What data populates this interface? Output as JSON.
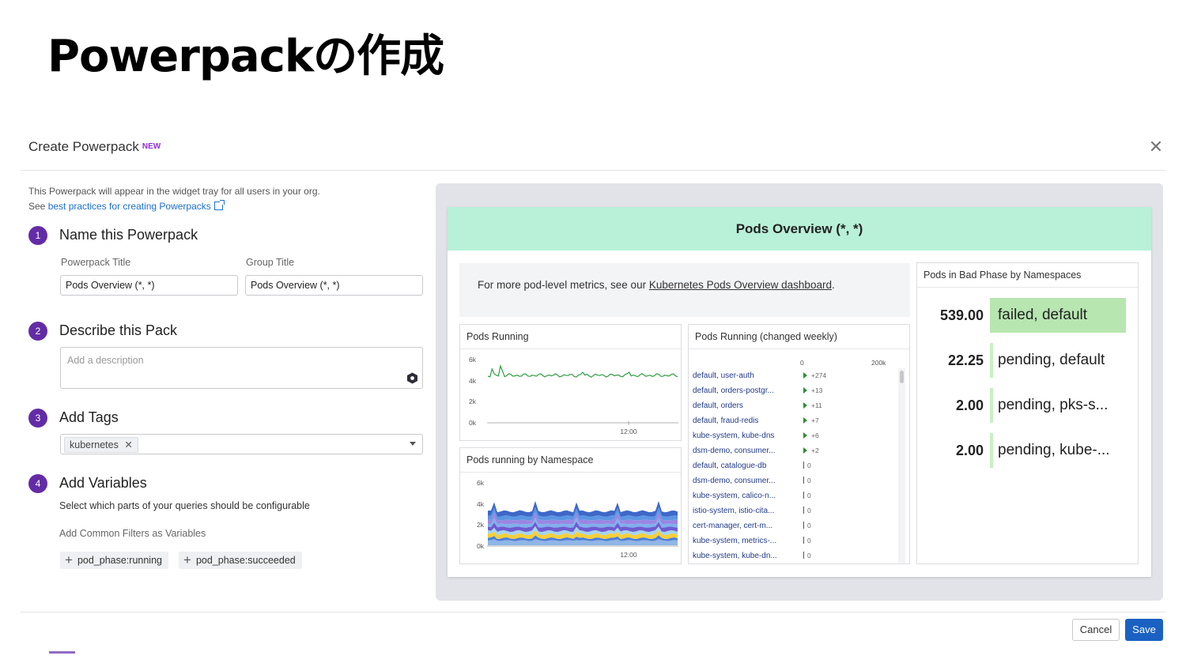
{
  "slide": {
    "title": "Powerpackの作成"
  },
  "modal": {
    "title": "Create Powerpack",
    "badge": "NEW",
    "intro_line1": "This Powerpack will appear in the widget tray for all users in your org.",
    "intro_see": "See ",
    "intro_link": "best practices for creating Powerpacks"
  },
  "steps": [
    {
      "num": "1",
      "title": "Name this Powerpack"
    },
    {
      "num": "2",
      "title": "Describe this Pack"
    },
    {
      "num": "3",
      "title": "Add Tags"
    },
    {
      "num": "4",
      "title": "Add Variables"
    }
  ],
  "name_step": {
    "powerpack_title_label": "Powerpack Title",
    "powerpack_title_value": "Pods Overview (*, *)",
    "group_title_label": "Group Title",
    "group_title_value": "Pods Overview (*, *)"
  },
  "describe_step": {
    "placeholder": "Add a description"
  },
  "tags_step": {
    "tags": [
      "kubernetes"
    ]
  },
  "variables_step": {
    "subtitle": "Select which parts of your queries should be configurable",
    "common_filters_label": "Add Common Filters as Variables",
    "filters": [
      "pod_phase:running",
      "pod_phase:succeeded"
    ]
  },
  "preview": {
    "header": "Pods Overview (*, *)",
    "note_prefix": "For more pod-level metrics, see our ",
    "note_link": "Kubernetes Pods Overview dashboard",
    "note_suffix": ".",
    "pods_running": {
      "title": "Pods Running",
      "y_ticks": [
        "6k",
        "4k",
        "2k",
        "0k"
      ],
      "x_tick": "12:00"
    },
    "pods_by_namespace": {
      "title": "Pods running by Namespace",
      "y_ticks": [
        "6k",
        "4k",
        "2k",
        "0k"
      ],
      "x_tick": "12:00"
    },
    "changed_weekly": {
      "title": "Pods Running (changed weekly)",
      "axis_left": "0",
      "axis_right": "200k",
      "rows": [
        {
          "name": "default, user-auth",
          "value": "+274",
          "up": true
        },
        {
          "name": "default, orders-postgr...",
          "value": "+13",
          "up": true
        },
        {
          "name": "default, orders",
          "value": "+11",
          "up": true
        },
        {
          "name": "default, fraud-redis",
          "value": "+7",
          "up": true
        },
        {
          "name": "kube-system, kube-dns",
          "value": "+6",
          "up": true
        },
        {
          "name": "dsm-demo, consumer...",
          "value": "+2",
          "up": true
        },
        {
          "name": "default, catalogue-db",
          "value": "0",
          "up": false
        },
        {
          "name": "dsm-demo, consumer...",
          "value": "0",
          "up": false
        },
        {
          "name": "kube-system, calico-n...",
          "value": "0",
          "up": false
        },
        {
          "name": "istio-system, istio-cita...",
          "value": "0",
          "up": false
        },
        {
          "name": "cert-manager, cert-m...",
          "value": "0",
          "up": false
        },
        {
          "name": "kube-system, metrics-...",
          "value": "0",
          "up": false
        },
        {
          "name": "kube-system, kube-dn...",
          "value": "0",
          "up": false
        }
      ]
    },
    "bad_phase": {
      "title": "Pods in Bad Phase by Namespaces",
      "rows": [
        {
          "value": "539.00",
          "label": "failed, default",
          "highlight": true
        },
        {
          "value": "22.25",
          "label": "pending, default",
          "highlight": false
        },
        {
          "value": "2.00",
          "label": "pending, pks-s...",
          "highlight": false
        },
        {
          "value": "2.00",
          "label": "pending, kube-...",
          "highlight": false
        }
      ]
    }
  },
  "footer": {
    "cancel": "Cancel",
    "save": "Save"
  },
  "colors": {
    "accent": "#632ca6",
    "link": "#1c6fd2",
    "save": "#1a61c2",
    "header_green": "#b9f0d8",
    "highlight_green": "#b7e6b0"
  }
}
